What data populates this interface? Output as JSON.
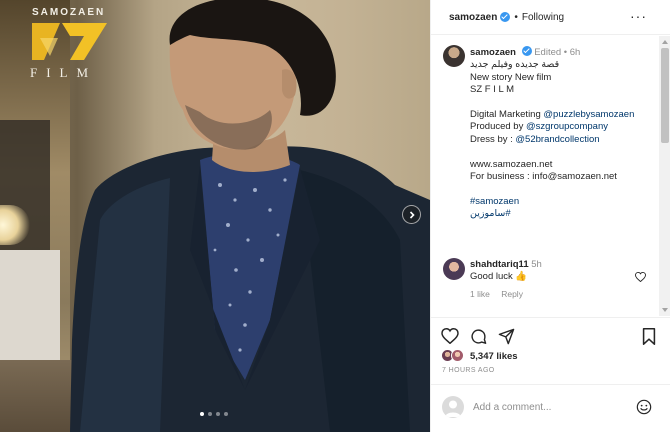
{
  "post": {
    "brand_logo_letters": "SAMOZAEN",
    "brand_logo_film": "FILM",
    "carousel": {
      "total": 4,
      "active": 1
    },
    "icons": {
      "next": "chevron-right-icon"
    }
  },
  "header": {
    "username": "samozaen",
    "separator": "•",
    "follow_status": "Following",
    "more": "···"
  },
  "caption": {
    "username": "samozaen",
    "edited": "Edited",
    "separator": "•",
    "time": "6h",
    "lines": {
      "arabic": "قصة جديده وفيلم جديد",
      "english": "New story New film",
      "sz": "SZ F I L M",
      "digital_prefix": "Digital Marketing ",
      "digital_link": "@puzzlebysamozaen",
      "produced_prefix": "Produced by ",
      "produced_link": "@szgroupcompany",
      "dress_prefix": "Dress by : ",
      "dress_link": "@52brandcollection",
      "website": "www.samozaen.net",
      "business": "For business : info@samozaen.net",
      "hashtag1": "#samozaen",
      "hashtag2": "#ساموزين"
    }
  },
  "comment": {
    "username": "shahdtariq11",
    "time": "5h",
    "text": "Good luck 👍",
    "likes": "1 like",
    "reply": "Reply"
  },
  "actions": {
    "icons": [
      "heart-icon",
      "comment-icon",
      "share-icon",
      "bookmark-icon"
    ]
  },
  "likes": {
    "count": "5,347 likes"
  },
  "time_ago": "7 HOURS AGO",
  "add_comment": {
    "placeholder": "Add a comment..."
  },
  "colors": {
    "link": "#00376b",
    "verified": "#3897f0",
    "muted": "#8e8e8e",
    "text": "#262626"
  }
}
